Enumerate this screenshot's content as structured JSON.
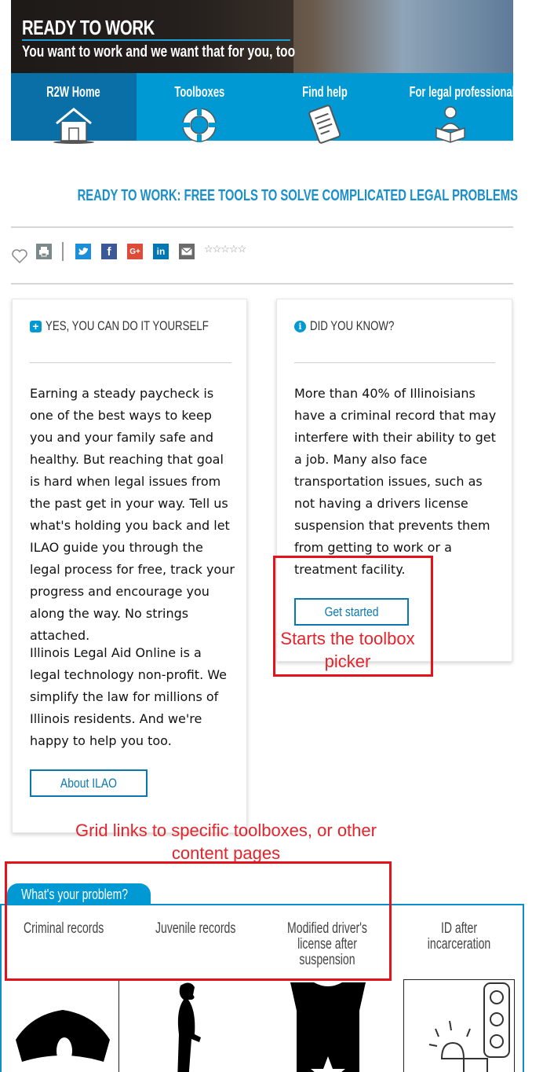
{
  "hero": {
    "title": "READY TO WORK",
    "subtitle": "You want to work and we want that for you, too"
  },
  "nav": {
    "items": [
      {
        "label": "R2W Home",
        "icon": "house-icon"
      },
      {
        "label": "Toolboxes",
        "icon": "life-ring-icon"
      },
      {
        "label": "Find help",
        "icon": "tablet-icon"
      },
      {
        "label": "For legal professionals",
        "icon": "reader-icon"
      }
    ]
  },
  "headline": "READY TO WORK: FREE TOOLS TO SOLVE COMPLICATED LEGAL PROBLEMS",
  "share": {
    "icons": [
      "heart-icon",
      "print-icon",
      "twitter-icon",
      "facebook-icon",
      "google-plus-icon",
      "linkedin-icon",
      "email-icon"
    ],
    "facebook_glyph": "f",
    "google_glyph": "G+",
    "linkedin_glyph": "in",
    "twitter_glyph": "t",
    "stars": "☆☆☆☆☆"
  },
  "card_left": {
    "heading": "YES, YOU CAN DO IT YOURSELF",
    "para1": "Earning a steady paycheck is one of the best ways to keep you and your family safe and healthy. But reaching that goal is hard when legal issues from the past get in your way. Tell us what's holding you back and let ILAO guide you through the legal process for free, track your progress and encourage you along the way. No strings attached.",
    "para2": "Illinois Legal Aid Online is a legal technology non-profit. We simplify the law for millions of Illinois residents. And we're happy to help you too.",
    "button": "About ILAO"
  },
  "card_right": {
    "heading": "DID YOU KNOW?",
    "para": "More than 40% of Illinoisians have a criminal record that may interfere with their ability to get a job. Many also face transportation issues, such as not having a drivers license suspension that prevents them from getting to work or a treatment facility.",
    "button": "Get started"
  },
  "annotations": {
    "toolbox_picker": "Starts the toolbox picker",
    "grid_links": "Grid links to specific toolboxes, or other content pages"
  },
  "problems": {
    "tab": "What's your problem?",
    "items": [
      "Criminal records",
      "Juvenile records",
      "Modified driver's license after suspension",
      "ID after incarceration"
    ]
  },
  "colors": {
    "brand_blue": "#0099d4",
    "nav_active": "#0a6fa6",
    "annotation_red": "#e4131b"
  }
}
